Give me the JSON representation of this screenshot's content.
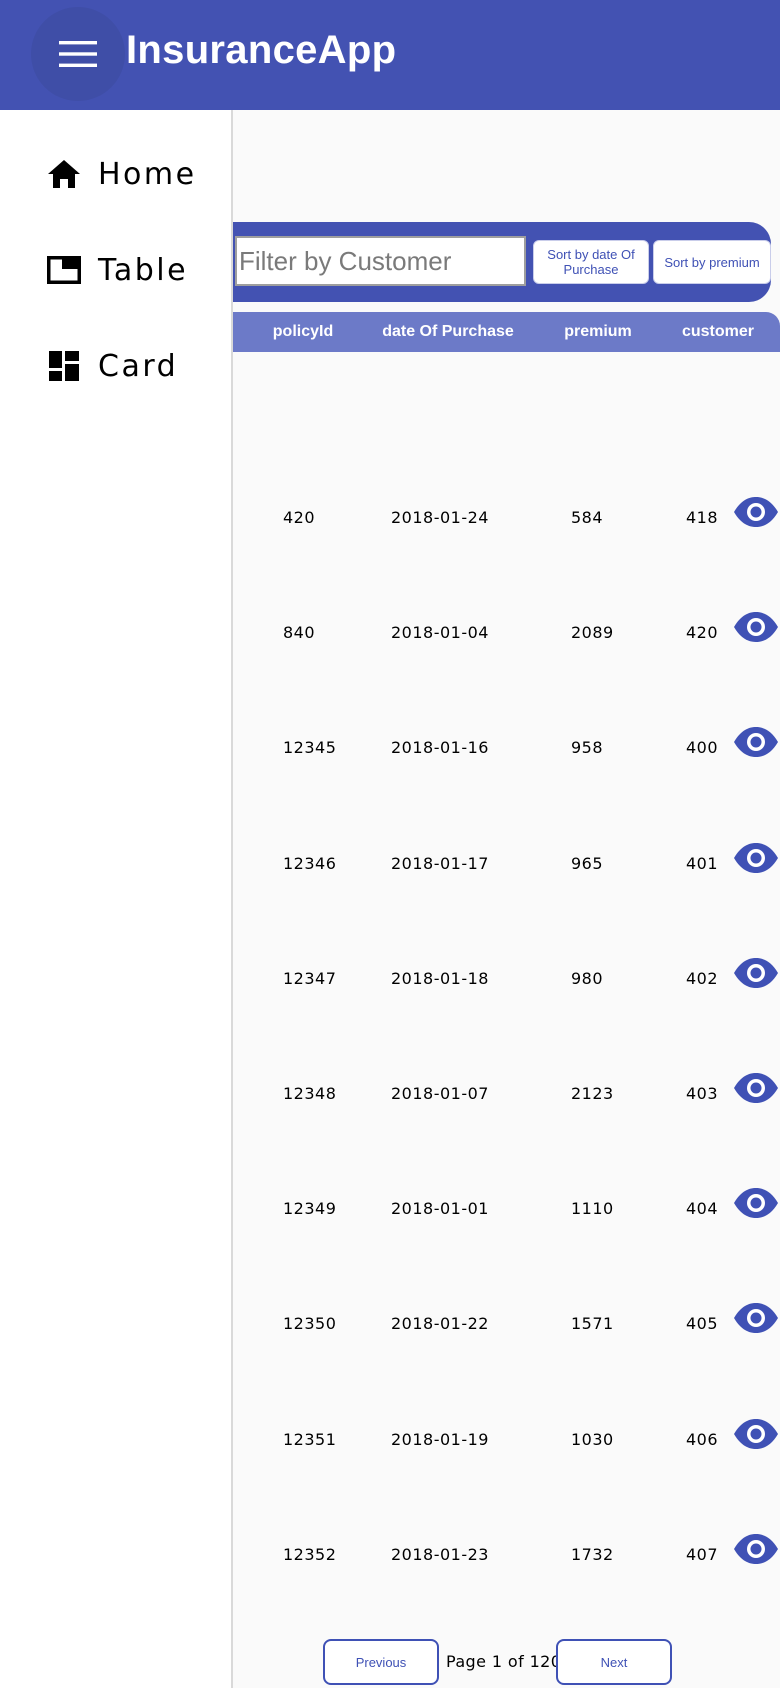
{
  "app": {
    "title": "InsuranceApp",
    "menu_icon": "hamburger-menu-icon",
    "brand_color": "#4352b2"
  },
  "sidebar": {
    "items": [
      {
        "label": "Home",
        "icon": "home-icon"
      },
      {
        "label": "Table",
        "icon": "table-window-icon"
      },
      {
        "label": "Card",
        "icon": "dashboard-card-icon"
      }
    ]
  },
  "filter": {
    "placeholder": "Filter by Customer",
    "value": "",
    "sort_date_label": "Sort by date Of Purchase",
    "sort_premium_label": "Sort by premium"
  },
  "table": {
    "columns": [
      "policyId",
      "date Of Purchase",
      "premium",
      "customer"
    ],
    "row_action_icon": "eye-icon",
    "rows": [
      {
        "policyId": "420",
        "date": "2018-01-24",
        "premium": "584",
        "customer": "418"
      },
      {
        "policyId": "840",
        "date": "2018-01-04",
        "premium": "2089",
        "customer": "420"
      },
      {
        "policyId": "12345",
        "date": "2018-01-16",
        "premium": "958",
        "customer": "400"
      },
      {
        "policyId": "12346",
        "date": "2018-01-17",
        "premium": "965",
        "customer": "401"
      },
      {
        "policyId": "12347",
        "date": "2018-01-18",
        "premium": "980",
        "customer": "402"
      },
      {
        "policyId": "12348",
        "date": "2018-01-07",
        "premium": "2123",
        "customer": "403"
      },
      {
        "policyId": "12349",
        "date": "2018-01-01",
        "premium": "1110",
        "customer": "404"
      },
      {
        "policyId": "12350",
        "date": "2018-01-22",
        "premium": "1571",
        "customer": "405"
      },
      {
        "policyId": "12351",
        "date": "2018-01-19",
        "premium": "1030",
        "customer": "406"
      },
      {
        "policyId": "12352",
        "date": "2018-01-23",
        "premium": "1732",
        "customer": "407"
      }
    ]
  },
  "pagination": {
    "previous_label": "Previous",
    "next_label": "Next",
    "page_info": "Page 1 of 120"
  }
}
